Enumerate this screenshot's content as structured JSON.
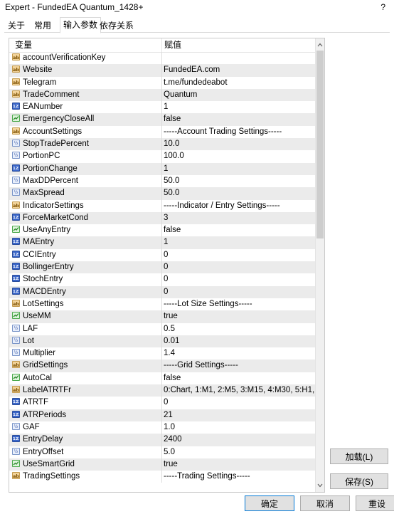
{
  "window": {
    "title": "Expert - FundedEA Quantum_1428+",
    "help": "?"
  },
  "tabs": [
    {
      "label": "关于"
    },
    {
      "label": "常用"
    },
    {
      "label": "输入参数",
      "active": true
    },
    {
      "label": "依存关系"
    }
  ],
  "grid": {
    "headers": {
      "variable": "变量",
      "value": "赋值"
    },
    "rows": [
      {
        "type": "string",
        "name": "accountVerificationKey",
        "value": ""
      },
      {
        "type": "string",
        "name": "Website",
        "value": "FundedEA.com"
      },
      {
        "type": "string",
        "name": "Telegram",
        "value": "t.me/fundedeabot"
      },
      {
        "type": "string",
        "name": "TradeComment",
        "value": "Quantum"
      },
      {
        "type": "int",
        "name": "EANumber",
        "value": "1"
      },
      {
        "type": "bool",
        "name": "EmergencyCloseAll",
        "value": "false"
      },
      {
        "type": "string",
        "name": "AccountSettings",
        "value": "-----Account Trading Settings-----"
      },
      {
        "type": "double",
        "name": "StopTradePercent",
        "value": "10.0"
      },
      {
        "type": "double",
        "name": "PortionPC",
        "value": "100.0"
      },
      {
        "type": "int",
        "name": "PortionChange",
        "value": "1"
      },
      {
        "type": "double",
        "name": "MaxDDPercent",
        "value": "50.0"
      },
      {
        "type": "double",
        "name": "MaxSpread",
        "value": "50.0"
      },
      {
        "type": "string",
        "name": "IndicatorSettings",
        "value": "-----Indicator / Entry Settings-----"
      },
      {
        "type": "int",
        "name": "ForceMarketCond",
        "value": "3"
      },
      {
        "type": "bool",
        "name": "UseAnyEntry",
        "value": "false"
      },
      {
        "type": "int",
        "name": "MAEntry",
        "value": "1"
      },
      {
        "type": "int",
        "name": "CCIEntry",
        "value": "0"
      },
      {
        "type": "int",
        "name": "BollingerEntry",
        "value": "0"
      },
      {
        "type": "int",
        "name": "StochEntry",
        "value": "0"
      },
      {
        "type": "int",
        "name": "MACDEntry",
        "value": "0"
      },
      {
        "type": "string",
        "name": "LotSettings",
        "value": "-----Lot Size Settings-----"
      },
      {
        "type": "bool",
        "name": "UseMM",
        "value": "true"
      },
      {
        "type": "double",
        "name": "LAF",
        "value": "0.5"
      },
      {
        "type": "double",
        "name": "Lot",
        "value": "0.01"
      },
      {
        "type": "double",
        "name": "Multiplier",
        "value": "1.4"
      },
      {
        "type": "string",
        "name": "GridSettings",
        "value": "-----Grid Settings-----"
      },
      {
        "type": "bool",
        "name": "AutoCal",
        "value": "false"
      },
      {
        "type": "string",
        "name": "LabelATRTFr",
        "value": "0:Chart, 1:M1, 2:M5, 3:M15, 4:M30, 5:H1, ..."
      },
      {
        "type": "int",
        "name": "ATRTF",
        "value": "0"
      },
      {
        "type": "int",
        "name": "ATRPeriods",
        "value": "21"
      },
      {
        "type": "double",
        "name": "GAF",
        "value": "1.0"
      },
      {
        "type": "int",
        "name": "EntryDelay",
        "value": "2400"
      },
      {
        "type": "double",
        "name": "EntryOffset",
        "value": "5.0"
      },
      {
        "type": "bool",
        "name": "UseSmartGrid",
        "value": "true"
      },
      {
        "type": "string",
        "name": "TradingSettings",
        "value": "-----Trading Settings-----"
      }
    ]
  },
  "buttons": {
    "load": "加载(L)",
    "save": "保存(S)",
    "ok": "确定",
    "cancel": "取消",
    "reset": "重设"
  },
  "icons": {
    "string": "string-param-icon",
    "int": "int-param-icon",
    "double": "double-param-icon",
    "bool": "bool-param-icon"
  },
  "colors": {
    "row_alt": "#ebebeb",
    "int_icon": "#3a66c9",
    "string_icon": "#f2d39a",
    "bool_icon": "#4aa84a",
    "primary_border": "#0078d7"
  }
}
